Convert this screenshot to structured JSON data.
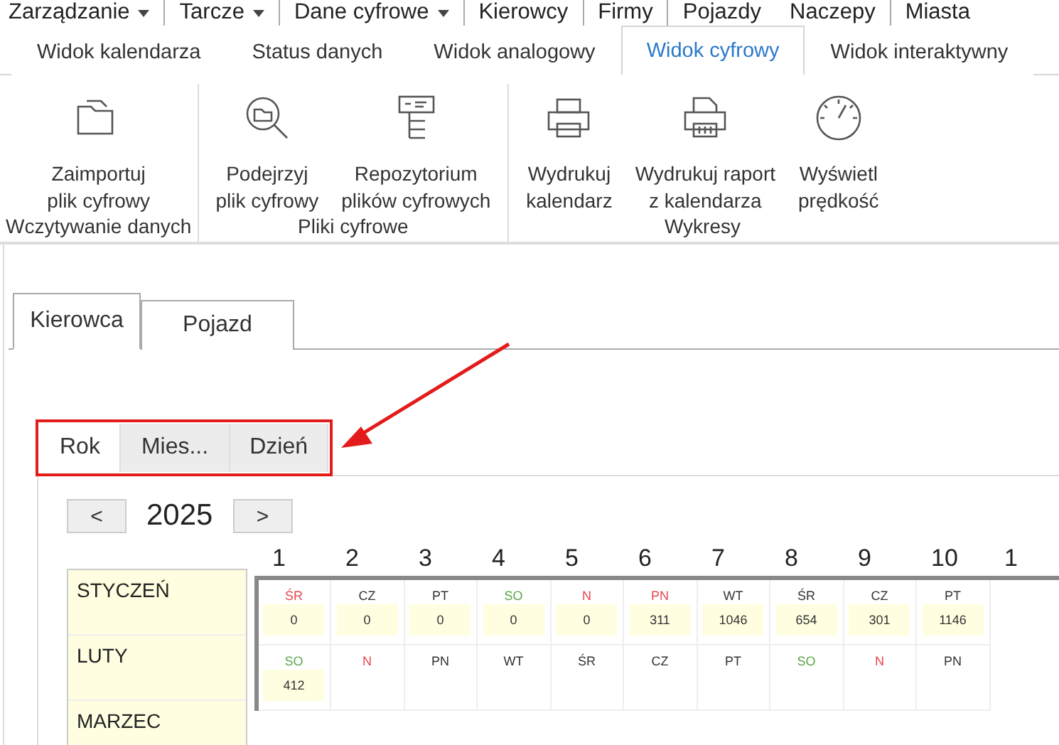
{
  "menu": [
    {
      "label": "Zarządzanie",
      "dropdown": true,
      "separator": true
    },
    {
      "label": "Tarcze",
      "dropdown": true,
      "separator": true
    },
    {
      "label": "Dane cyfrowe",
      "dropdown": true,
      "separator": true
    },
    {
      "label": "Kierowcy",
      "dropdown": false,
      "separator": true
    },
    {
      "label": "Firmy",
      "dropdown": false,
      "separator": true
    },
    {
      "label": "Pojazdy",
      "dropdown": false,
      "separator": false
    },
    {
      "label": "Naczepy",
      "dropdown": false,
      "separator": true
    },
    {
      "label": "Miasta",
      "dropdown": false,
      "separator": false
    }
  ],
  "ribbon_tabs": [
    {
      "label": "Widok kalendarza",
      "selected": false
    },
    {
      "label": "Status danych",
      "selected": false
    },
    {
      "label": "Widok analogowy",
      "selected": false
    },
    {
      "label": "Widok cyfrowy",
      "selected": true
    },
    {
      "label": "Widok interaktywny",
      "selected": false
    }
  ],
  "ribbon_groups": [
    {
      "label": "Wczytywanie danych",
      "buttons": [
        {
          "kind": "folder",
          "lines": [
            "Zaimportuj",
            "plik cyfrowy"
          ]
        }
      ]
    },
    {
      "label": "Pliki cyfrowe",
      "buttons": [
        {
          "kind": "search",
          "lines": [
            "Podejrzyj",
            "plik cyfrowy"
          ]
        },
        {
          "kind": "repository",
          "lines": [
            "Repozytorium",
            "plików cyfrowych"
          ]
        }
      ]
    },
    {
      "label": "Wykresy",
      "buttons": [
        {
          "kind": "printer",
          "lines": [
            "Wydrukuj",
            "kalendarz"
          ]
        },
        {
          "kind": "report",
          "lines": [
            "Wydrukuj raport",
            "z kalendarza"
          ]
        },
        {
          "kind": "gauge",
          "lines": [
            "Wyświetl",
            "prędkość"
          ]
        }
      ]
    }
  ],
  "main_tabs": [
    {
      "label": "Kierowca",
      "selected": true
    },
    {
      "label": "Pojazd",
      "selected": false
    }
  ],
  "sub_tabs": [
    {
      "label": "Rok",
      "selected": true
    },
    {
      "label": "Mies...",
      "selected": false
    },
    {
      "label": "Dzień",
      "selected": false
    }
  ],
  "calendar": {
    "prev": "<",
    "year": "2025",
    "next": ">",
    "day_numbers": [
      "1",
      "2",
      "3",
      "4",
      "5",
      "6",
      "7",
      "8",
      "9",
      "10",
      "1"
    ],
    "months": [
      {
        "name": "STYCZEŃ",
        "days": [
          {
            "abbr": "ŚR",
            "color": "#e8474f",
            "value": "0"
          },
          {
            "abbr": "CZ",
            "color": "#333333",
            "value": "0"
          },
          {
            "abbr": "PT",
            "color": "#333333",
            "value": "0"
          },
          {
            "abbr": "SO",
            "color": "#5aa84a",
            "value": "0"
          },
          {
            "abbr": "N",
            "color": "#e8474f",
            "value": "0"
          },
          {
            "abbr": "PN",
            "color": "#e8474f",
            "value": "311"
          },
          {
            "abbr": "WT",
            "color": "#333333",
            "value": "1046"
          },
          {
            "abbr": "ŚR",
            "color": "#333333",
            "value": "654"
          },
          {
            "abbr": "CZ",
            "color": "#333333",
            "value": "301"
          },
          {
            "abbr": "PT",
            "color": "#333333",
            "value": "1146"
          }
        ]
      },
      {
        "name": "LUTY",
        "days": [
          {
            "abbr": "SO",
            "color": "#5aa84a",
            "value": "412"
          },
          {
            "abbr": "N",
            "color": "#e8474f"
          },
          {
            "abbr": "PN",
            "color": "#333333"
          },
          {
            "abbr": "WT",
            "color": "#333333"
          },
          {
            "abbr": "ŚR",
            "color": "#333333"
          },
          {
            "abbr": "CZ",
            "color": "#333333"
          },
          {
            "abbr": "PT",
            "color": "#333333"
          },
          {
            "abbr": "SO",
            "color": "#5aa84a"
          },
          {
            "abbr": "N",
            "color": "#e8474f"
          },
          {
            "abbr": "PN",
            "color": "#333333"
          }
        ]
      },
      {
        "name": "MARZEC"
      }
    ]
  }
}
